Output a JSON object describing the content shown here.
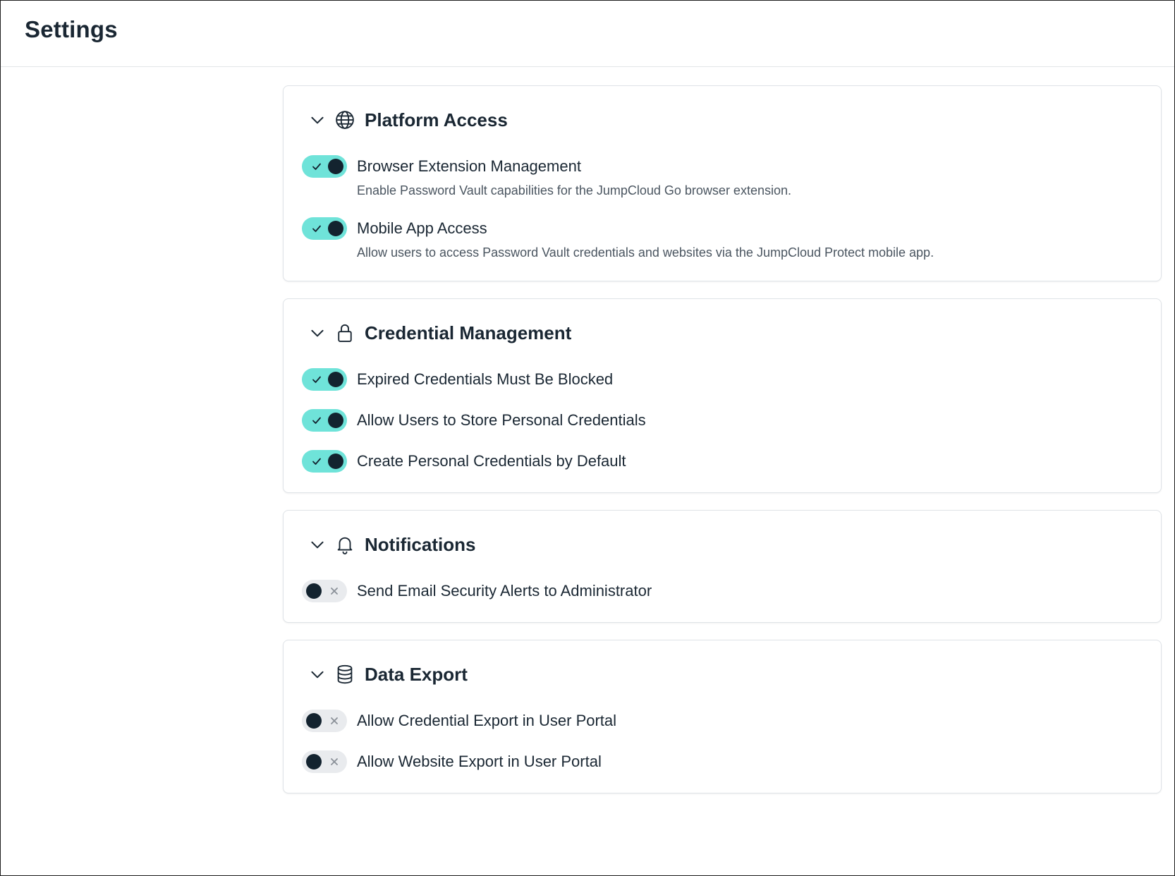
{
  "header": {
    "title": "Settings"
  },
  "sections": [
    {
      "title": "Platform Access",
      "icon": "globe-icon",
      "settings": [
        {
          "label": "Browser Extension Management",
          "description": "Enable Password Vault capabilities for the JumpCloud Go browser extension.",
          "enabled": true
        },
        {
          "label": "Mobile App Access",
          "description": "Allow users to access Password Vault credentials and websites via the JumpCloud Protect mobile app.",
          "enabled": true
        }
      ]
    },
    {
      "title": "Credential Management",
      "icon": "lock-icon",
      "settings": [
        {
          "label": "Expired Credentials Must Be Blocked",
          "enabled": true
        },
        {
          "label": "Allow Users to Store Personal Credentials",
          "enabled": true
        },
        {
          "label": "Create Personal Credentials by Default",
          "enabled": true
        }
      ]
    },
    {
      "title": "Notifications",
      "icon": "bell-icon",
      "settings": [
        {
          "label": "Send Email Security Alerts to Administrator",
          "enabled": false
        }
      ]
    },
    {
      "title": "Data Export",
      "icon": "database-icon",
      "settings": [
        {
          "label": "Allow Credential Export in User Portal",
          "enabled": false
        },
        {
          "label": "Allow Website Export in User Portal",
          "enabled": false
        }
      ]
    }
  ],
  "colors": {
    "toggle_on": "#6fe3d9",
    "toggle_off": "#e9ebee",
    "knob": "#13232f",
    "text": "#1a2733"
  }
}
